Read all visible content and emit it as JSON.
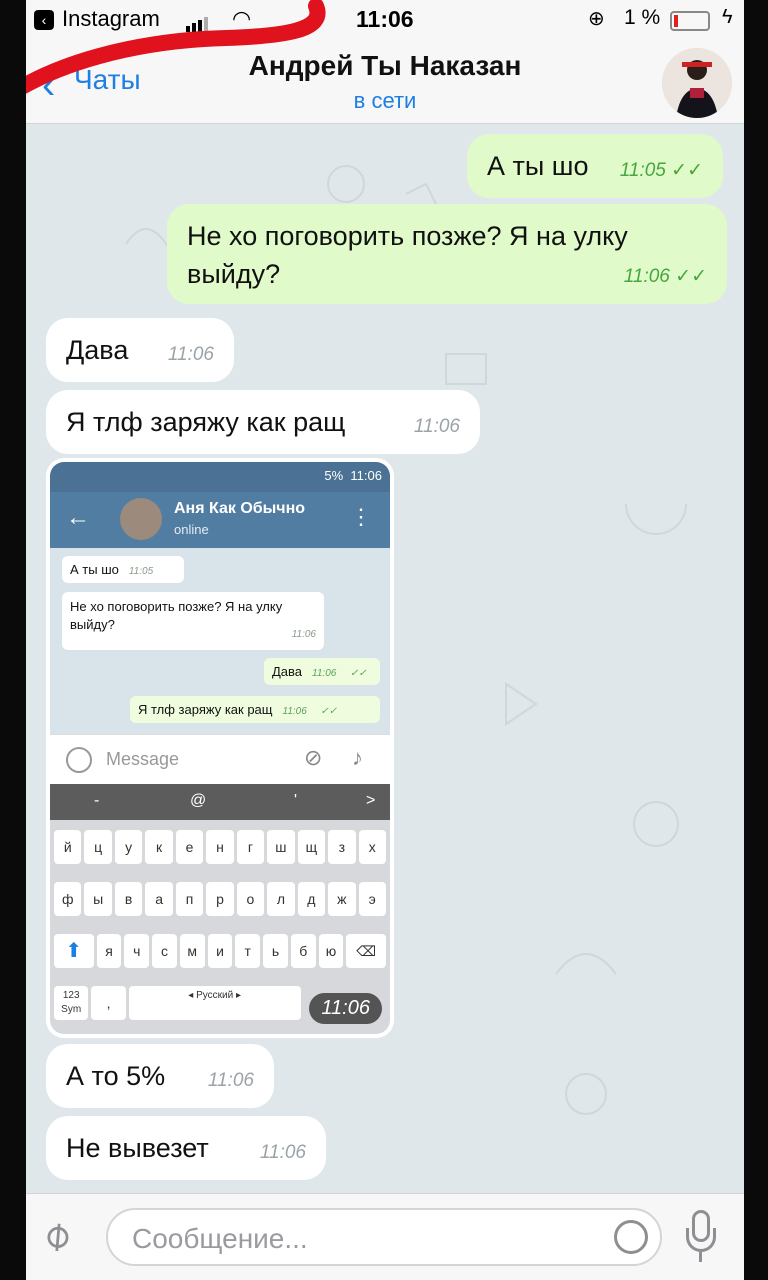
{
  "status_bar": {
    "back_app": "Instagram",
    "time": "11:06",
    "battery_pct": "1 %"
  },
  "header": {
    "back_label": "Чаты",
    "title": "Андрей Ты Наказан",
    "status": "в сети"
  },
  "messages": [
    {
      "dir": "out",
      "text": "А ты шо",
      "time": "11:05",
      "read": "✓✓"
    },
    {
      "dir": "out",
      "text": "Не хо поговорить позже? Я на улку выйду?",
      "time": "11:06",
      "read": "✓✓"
    },
    {
      "dir": "in",
      "text": "Дава",
      "time": "11:06"
    },
    {
      "dir": "in",
      "text": "Я тлф заряжу как ращ",
      "time": "11:06"
    },
    {
      "dir": "in",
      "text": "А то 5%",
      "time": "11:06"
    },
    {
      "dir": "in",
      "text": "Не вывезет",
      "time": "11:06"
    }
  ],
  "image_message": {
    "time": "11:06",
    "screenshot": {
      "status_time": "11:06",
      "status_battery": "5%",
      "contact_name": "Аня Как Обычно",
      "contact_status": "online",
      "bubbles": [
        {
          "text": "А ты шо",
          "time": "11:05"
        },
        {
          "text": "Не хо поговорить позже? Я на улку выйду?",
          "time": "11:06"
        },
        {
          "text": "Дава",
          "time": "11:06"
        },
        {
          "text": "Я тлф заряжу как ращ",
          "time": "11:06"
        }
      ],
      "input_placeholder": "Message",
      "keyboard_top": [
        "-",
        "@",
        "'",
        ">"
      ],
      "keyboard_rows": [
        [
          "й",
          "ц",
          "у",
          "к",
          "е",
          "н",
          "г",
          "ш",
          "щ",
          "з",
          "х"
        ],
        [
          "ф",
          "ы",
          "в",
          "а",
          "п",
          "р",
          "о",
          "л",
          "д",
          "ж",
          "э"
        ],
        [
          "я",
          "ч",
          "с",
          "м",
          "и",
          "т",
          "ь",
          "б",
          "ю"
        ]
      ],
      "sym_key": "123 Sym",
      "comma_key": ",",
      "space_label": "◂ Русский ▸"
    }
  },
  "input_bar": {
    "placeholder": "Сообщение..."
  }
}
